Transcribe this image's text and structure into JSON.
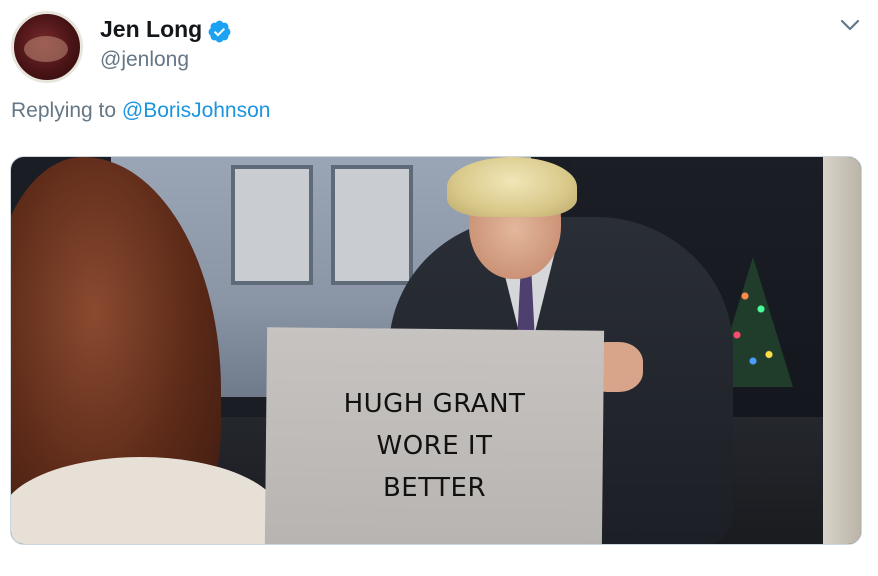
{
  "tweet": {
    "author_name": "Jen Long",
    "author_handle": "@jenlong",
    "verified": true,
    "replying_prefix": "Replying to",
    "replying_to": "@BorisJohnson",
    "media": {
      "sign_lines": [
        "HUGH GRANT",
        "WORE IT",
        "BETTER"
      ]
    }
  },
  "icons": {
    "verified": "verified-badge-icon",
    "menu": "chevron-down-icon"
  },
  "colors": {
    "text_primary": "#14171a",
    "text_secondary": "#657786",
    "link": "#1b95e0",
    "verified": "#1da1f2"
  }
}
